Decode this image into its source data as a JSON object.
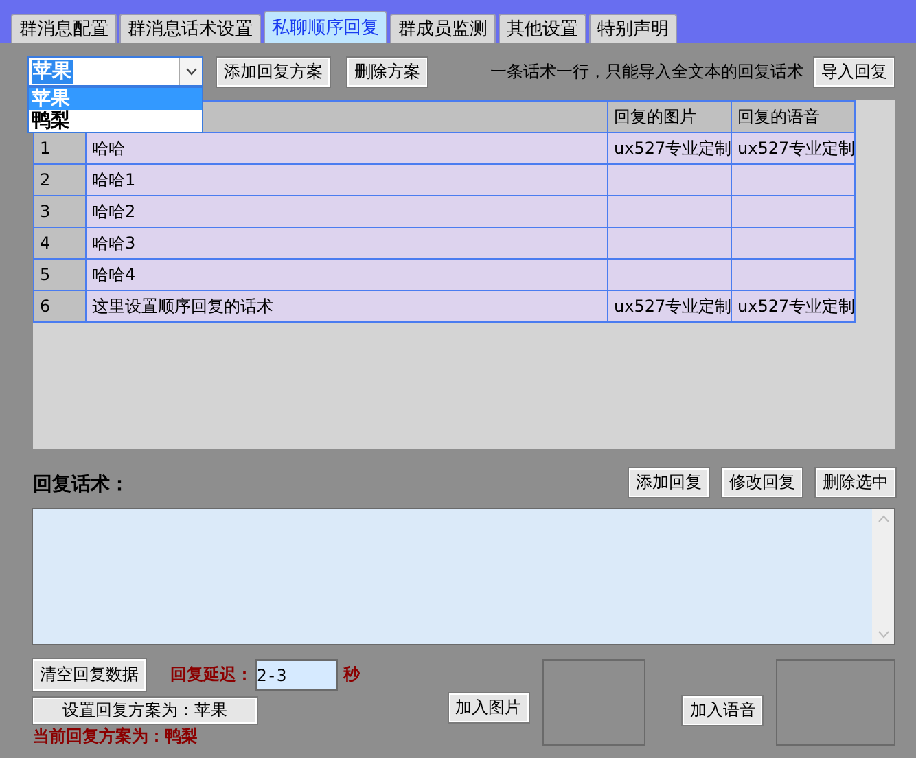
{
  "tabs": [
    {
      "label": "群消息配置",
      "selected": false
    },
    {
      "label": "群消息话术设置",
      "selected": false
    },
    {
      "label": "私聊顺序回复",
      "selected": true
    },
    {
      "label": "群成员监测",
      "selected": false
    },
    {
      "label": "其他设置",
      "selected": false
    },
    {
      "label": "特别声明",
      "selected": false
    }
  ],
  "scheme_select": {
    "value": "苹果",
    "expanded": true,
    "options": [
      {
        "label": "苹果",
        "selected": true
      },
      {
        "label": "鸭梨",
        "selected": false
      }
    ]
  },
  "top_buttons": [
    "添加回复方案",
    "删除方案"
  ],
  "import_hint": "一条话术一行，只能导入全文本的回复话术",
  "import_button": "导入回复",
  "table": {
    "columns": [
      "回复的图片",
      "回复的语音"
    ],
    "rows": [
      {
        "index": "1",
        "text": "哈哈",
        "image": "ux527专业定制",
        "voice": "ux527专业定制"
      },
      {
        "index": "2",
        "text": "哈哈1"
      },
      {
        "index": "3",
        "text": "哈哈2"
      },
      {
        "index": "4",
        "text": "哈哈3"
      },
      {
        "index": "5",
        "text": "哈哈4"
      },
      {
        "index": "6",
        "text": "这里设置顺序回复的话术",
        "image": "ux527专业定制",
        "voice": "ux527专业定制"
      }
    ]
  },
  "reply_label": "回复话术：",
  "reply_buttons": [
    "添加回复",
    "修改回复",
    "删除选中"
  ],
  "clear_button": "清空回复数据",
  "delay": {
    "label": "回复延迟：",
    "value": "2-3",
    "unit": "秒"
  },
  "set_scheme_button": "设置回复方案为：苹果",
  "current_scheme": "当前回复方案为：鸭梨",
  "add_image_button": "加入图片",
  "add_voice_button": "加入语音"
}
